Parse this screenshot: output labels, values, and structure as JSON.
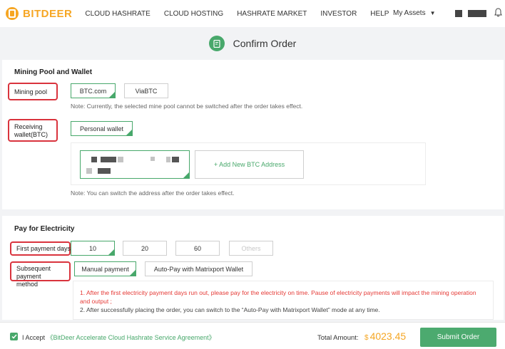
{
  "brand": {
    "name": "BITDEER"
  },
  "nav": {
    "items": [
      "CLOUD HASHRATE",
      "CLOUD HOSTING",
      "HASHRATE MARKET",
      "INVESTOR",
      "HELP"
    ],
    "assets_label": "My Assets"
  },
  "page": {
    "title": "Confirm Order"
  },
  "pool_wallet": {
    "heading": "Mining Pool and Wallet",
    "pool_label": "Mining pool",
    "pools": [
      "BTC.com",
      "ViaBTC"
    ],
    "selected_pool": "BTC.com",
    "pool_note": "Note: Currently, the selected mine pool cannot be switched after the order takes effect.",
    "wallet_label": "Receiving wallet(BTC)",
    "wallet_option": "Personal wallet",
    "add_address": "+ Add New BTC Address",
    "address_note": "Note: You can switch the address after the order takes effect."
  },
  "electricity": {
    "heading": "Pay for Electricity",
    "first_days_label": "First payment days",
    "days_options": [
      "10",
      "20",
      "60",
      "Others"
    ],
    "selected_days": "10",
    "method_label": "Subsequent payment method",
    "methods": [
      "Manual payment",
      "Auto-Pay with Matrixport Wallet"
    ],
    "selected_method": "Manual payment",
    "notes": [
      "1. After the first electricity payment days run out, please pay for the electricity on time. Pause of electricity payments will impact the mining operation and output ;",
      "2. After successfully placing the order, you can switch to the “Auto-Pay with Matrixport Wallet” mode at any time."
    ]
  },
  "footer": {
    "accept_prefix": "I Accept",
    "agreement": "《BitDeer Accelerate Cloud Hashrate Service Agreement》",
    "accepted": true,
    "total_label": "Total Amount:",
    "currency": "$",
    "amount": "4023.45",
    "submit_label": "Submit Order"
  },
  "colors": {
    "accent": "#48a86b",
    "brand": "#f6a623",
    "highlight": "#d9333d",
    "warning": "#e53935"
  }
}
